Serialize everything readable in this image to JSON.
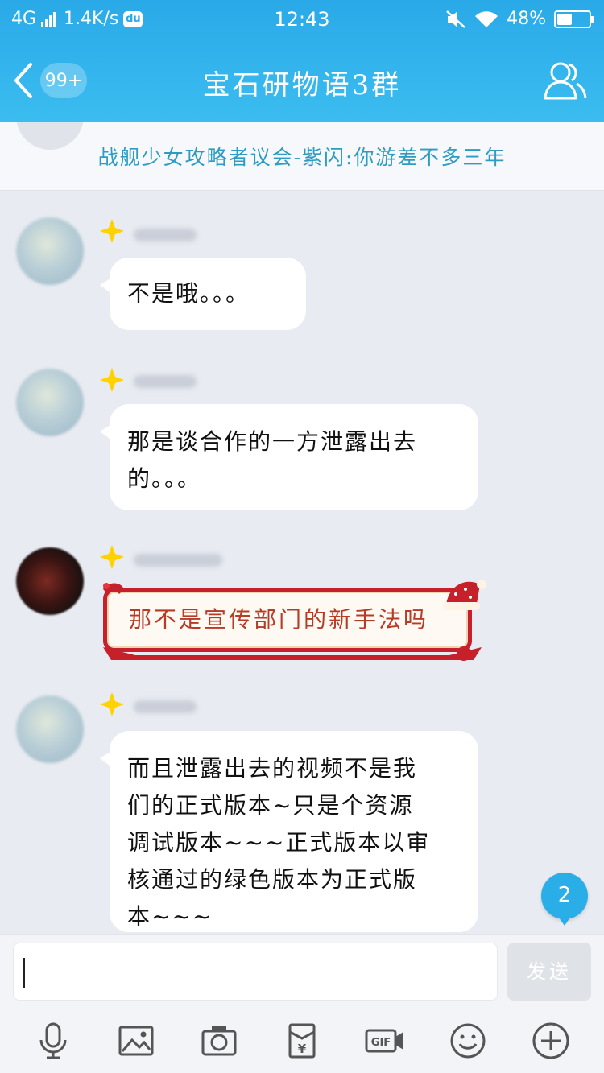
{
  "status_bar": {
    "network": "4G",
    "speed": "1.4K/s",
    "du_badge": "du",
    "time": "12:43",
    "battery": "48%",
    "battery_level": 0.48
  },
  "header": {
    "unread_count": "99+",
    "title": "宝石研物语3群"
  },
  "announcement": {
    "text": "战舰少女攻略者议会-紫闪:你游差不多三年"
  },
  "messages": [
    {
      "text": "不是哦。。。"
    },
    {
      "text_lines": [
        "那是谈合作的一方泄露出去",
        "的。。。"
      ]
    },
    {
      "text": "那不是宣传部门的新手法吗"
    },
    {
      "text_lines": [
        "而且泄露出去的视频不是我",
        "们的正式版本~只是个资源",
        "调试版本~~~正式版本以审",
        "核通过的绿色版本为正式版",
        "本~~~"
      ]
    }
  ],
  "new_messages_badge": "2",
  "input": {
    "value": "",
    "send_label": "发送"
  },
  "colors": {
    "accent": "#2aa9e8",
    "announcement_text": "#2c9cc3",
    "special_frame": "#c6202a",
    "special_text": "#b53c26"
  },
  "toolbar_icons": [
    "mic-icon",
    "image-icon",
    "camera-icon",
    "red-packet-icon",
    "gif-icon",
    "emoji-icon",
    "plus-icon"
  ]
}
